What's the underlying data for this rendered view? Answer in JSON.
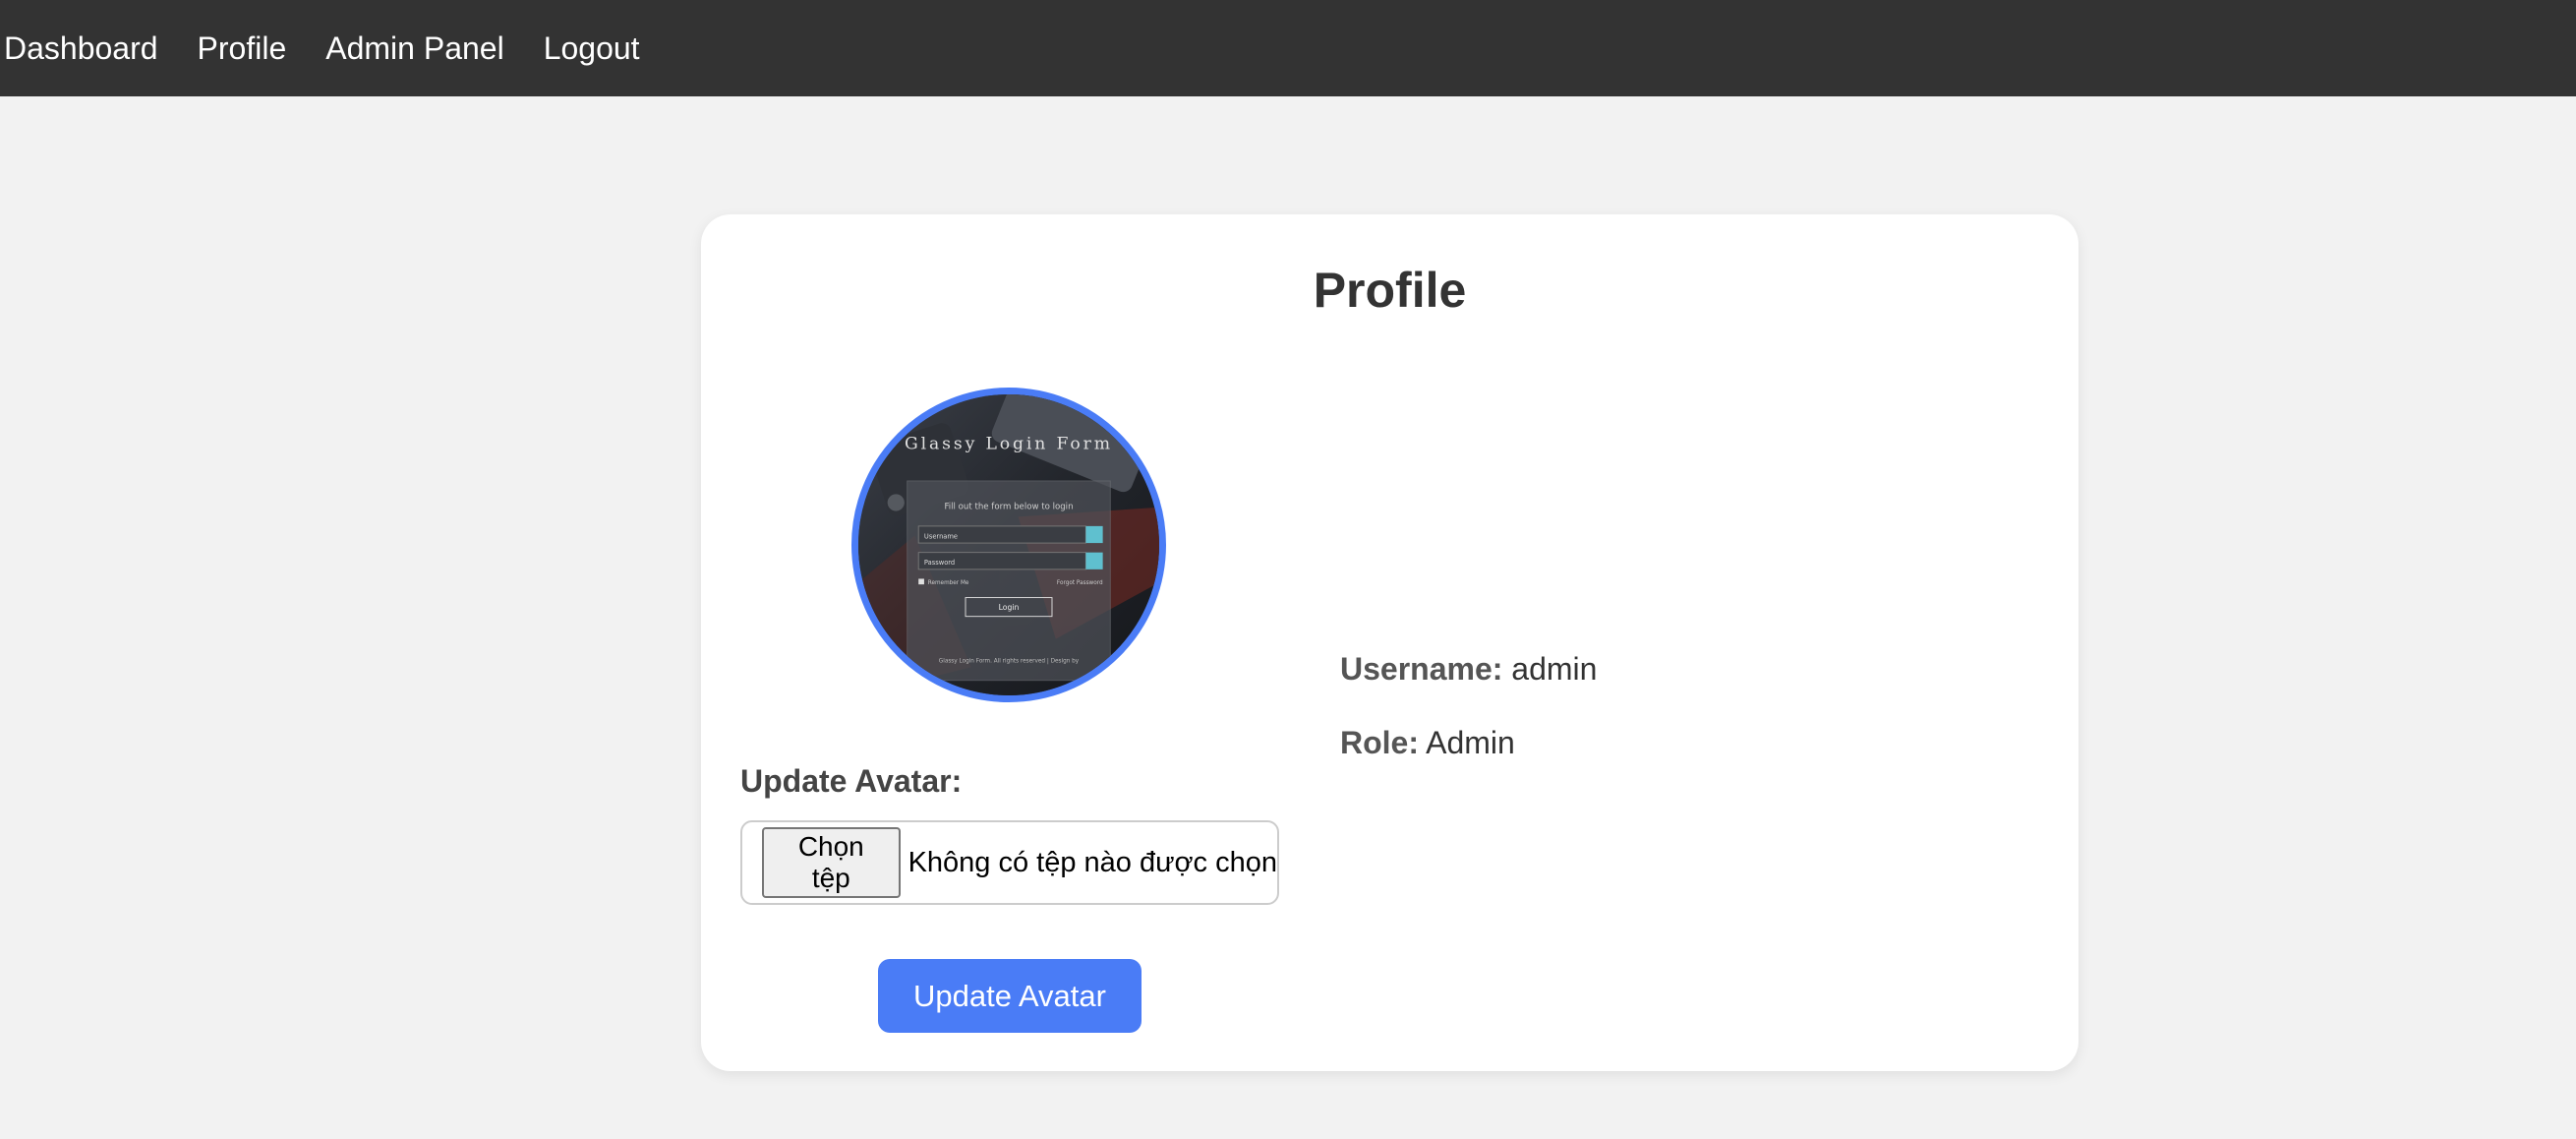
{
  "nav": {
    "items": [
      {
        "label": "Dashboard"
      },
      {
        "label": "Profile"
      },
      {
        "label": "Admin Panel"
      },
      {
        "label": "Logout"
      }
    ]
  },
  "profile": {
    "title": "Profile",
    "avatar_text": {
      "heading": "Glassy Login Form",
      "subheading": "Fill out the form below to login",
      "username": "Username",
      "password": "Password",
      "remember": "Remember Me",
      "forgot": "Forgot Password",
      "login": "Login",
      "footer": "Glassy Login Form. All rights reserved | Design by"
    },
    "update_label": "Update Avatar:",
    "file_button": "Chọn tệp",
    "file_status": "Không có tệp nào được chọn",
    "submit_label": "Update Avatar",
    "username_label": "Username:",
    "username_value": "admin",
    "role_label": "Role:",
    "role_value": "Admin"
  },
  "colors": {
    "navbar": "#333333",
    "accent": "#4a7cf6",
    "background": "#f2f2f2"
  }
}
